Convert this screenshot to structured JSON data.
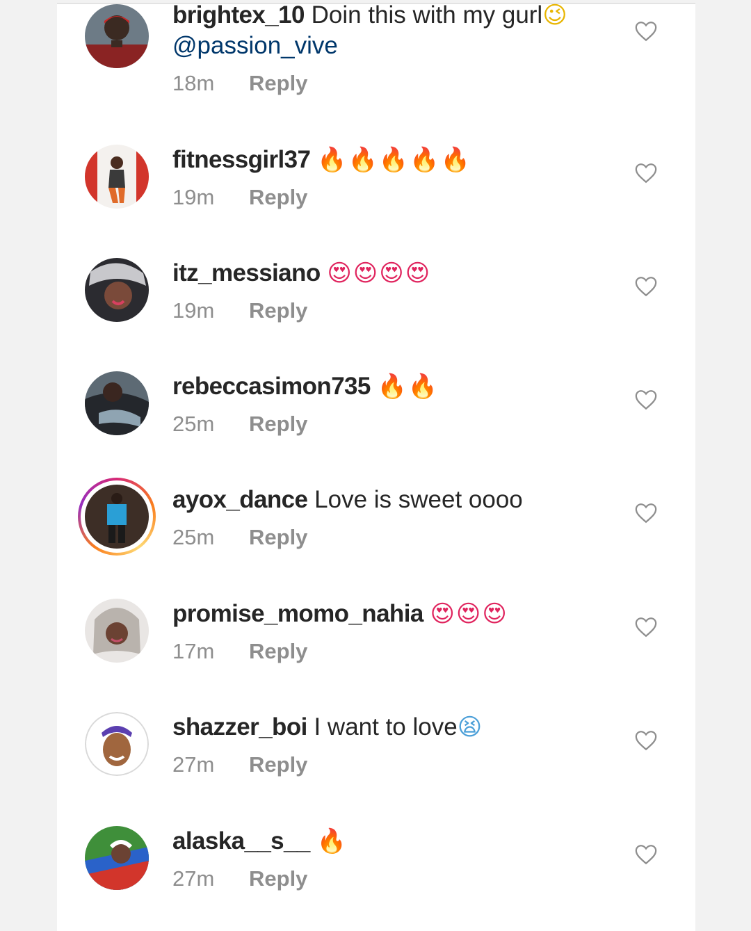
{
  "comments": [
    {
      "username": "brightex_10",
      "text": "Doin this with my gurl",
      "emoji": "😉",
      "mention": "@passion_vive",
      "time": "18m",
      "reply_label": "Reply"
    },
    {
      "username": "fitnessgirl37",
      "text": "",
      "emoji": "🔥🔥🔥🔥🔥",
      "time": "19m",
      "reply_label": "Reply"
    },
    {
      "username": "itz_messiano",
      "text": "",
      "emoji": "😍😍😍😍",
      "time": "19m",
      "reply_label": "Reply"
    },
    {
      "username": "rebeccasimon735",
      "text": "",
      "emoji": "🔥🔥",
      "time": "25m",
      "reply_label": "Reply"
    },
    {
      "username": "ayox_dance",
      "text": "Love is sweet oooo",
      "emoji": "",
      "time": "25m",
      "reply_label": "Reply"
    },
    {
      "username": "promise_momo_nahia",
      "text": "",
      "emoji": "😍😍😍",
      "time": "17m",
      "reply_label": "Reply"
    },
    {
      "username": "shazzer_boi",
      "text": "I want to love",
      "emoji": "😫",
      "time": "27m",
      "reply_label": "Reply"
    },
    {
      "username": "alaska__s__",
      "text": "",
      "emoji": "🔥",
      "time": "27m",
      "reply_label": "Reply"
    }
  ],
  "icons": {
    "like": "heart-outline-icon"
  },
  "colors": {
    "username": "#262626",
    "mention": "#00376b",
    "meta": "#8e8e8e",
    "heart_stroke": "#8e8e8e"
  }
}
